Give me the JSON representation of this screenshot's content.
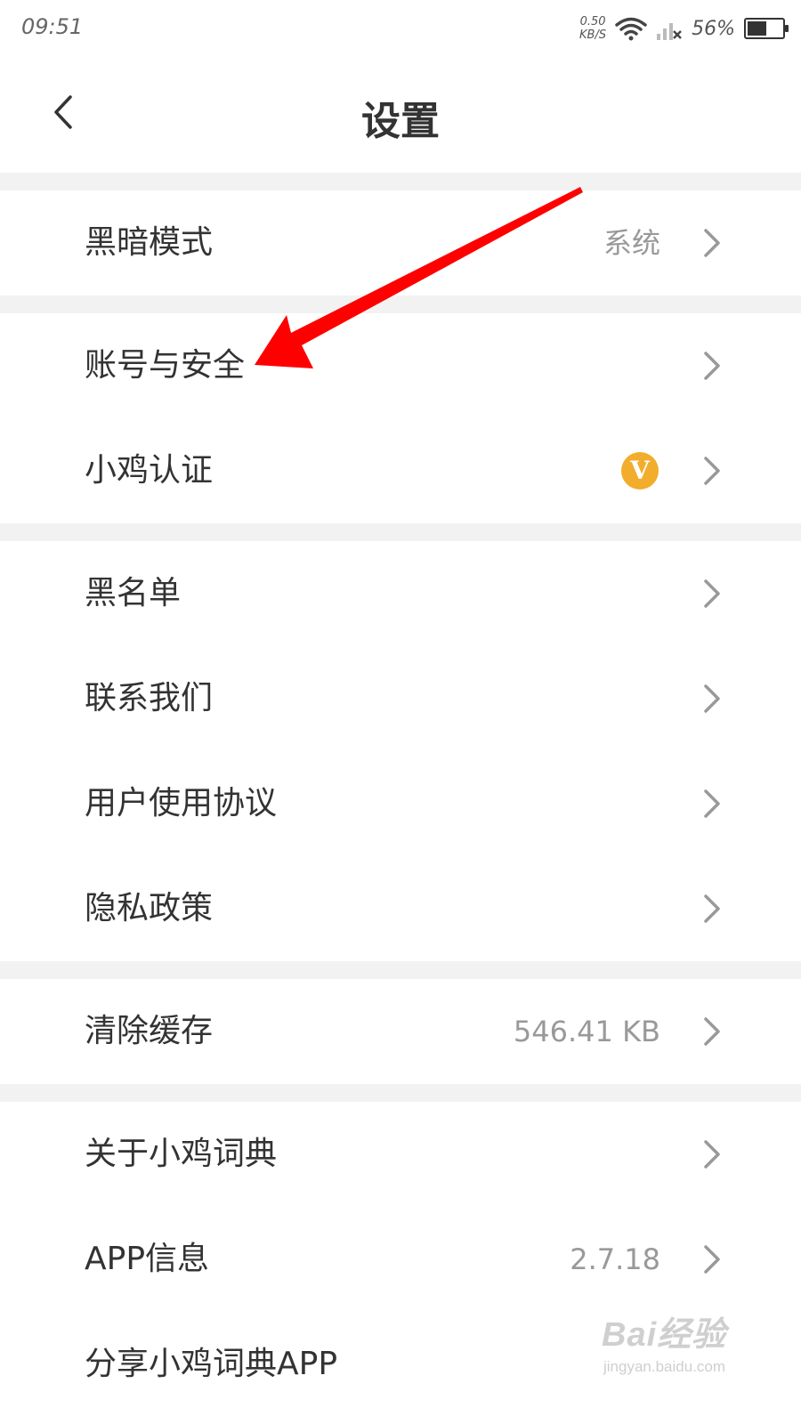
{
  "status_bar": {
    "time": "09:51",
    "net_speed_value": "0.50",
    "net_speed_unit": "KB/S",
    "battery_percent": "56%",
    "battery_level": 0.56
  },
  "header": {
    "title": "设置"
  },
  "rows": {
    "dark_mode": {
      "label": "黑暗模式",
      "value": "系统"
    },
    "account_security": {
      "label": "账号与安全"
    },
    "verification": {
      "label": "小鸡认证",
      "badge": "V"
    },
    "blacklist": {
      "label": "黑名单"
    },
    "contact_us": {
      "label": "联系我们"
    },
    "user_agreement": {
      "label": "用户使用协议"
    },
    "privacy_policy": {
      "label": "隐私政策"
    },
    "clear_cache": {
      "label": "清除缓存",
      "value": "546.41 KB"
    },
    "about": {
      "label": "关于小鸡词典"
    },
    "app_info": {
      "label": "APP信息",
      "value": "2.7.18"
    },
    "share": {
      "label": "分享小鸡词典APP"
    }
  },
  "watermark": {
    "logo": "Bai经验",
    "url": "jingyan.baidu.com"
  },
  "colors": {
    "annotation_arrow": "#ff0000",
    "badge": "#f2ad2c",
    "section_gap": "#f2f2f2"
  },
  "icons": {
    "back": "chevron-left-icon",
    "row_arrow": "chevron-right-icon",
    "wifi": "wifi-icon",
    "signal": "signal-icon",
    "battery": "battery-icon"
  }
}
